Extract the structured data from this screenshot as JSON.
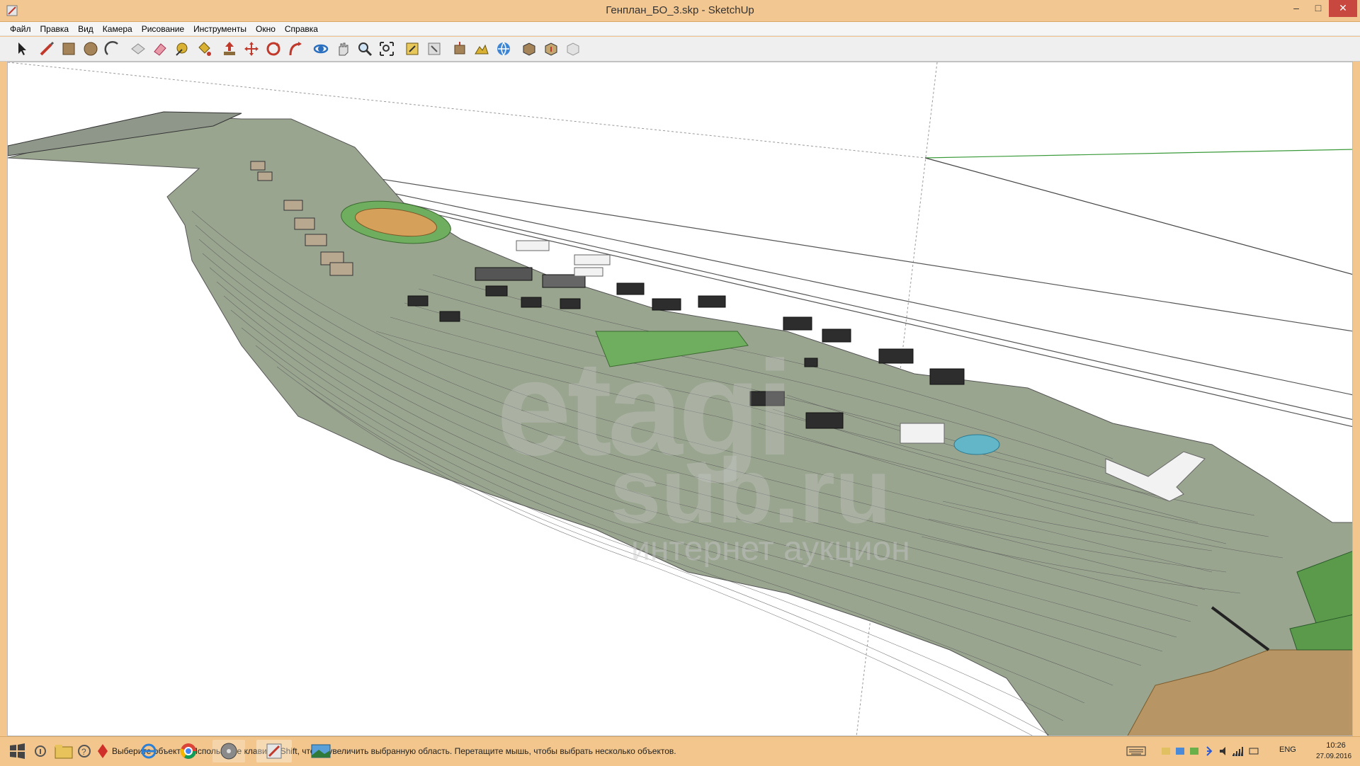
{
  "window": {
    "title": "Генплан_БО_3.skp - SketchUp",
    "controls": {
      "minimize": "–",
      "maximize": "□",
      "close": "✕"
    }
  },
  "menu": [
    {
      "label": "Файл"
    },
    {
      "label": "Правка"
    },
    {
      "label": "Вид"
    },
    {
      "label": "Камера"
    },
    {
      "label": "Рисование"
    },
    {
      "label": "Инструменты"
    },
    {
      "label": "Окно"
    },
    {
      "label": "Справка"
    }
  ],
  "toolbar": {
    "tools": [
      {
        "icon": "select-arrow-icon",
        "color": "#222222"
      },
      {
        "icon": "pencil-line-icon",
        "color": "#c0392b"
      },
      {
        "icon": "rectangle-icon",
        "color": "#8a6d3b"
      },
      {
        "icon": "circle-icon",
        "color": "#8a6d3b"
      },
      {
        "icon": "arc-icon",
        "color": "#444444"
      },
      {
        "icon": "make-component-icon",
        "color": "#9a9a9a"
      },
      {
        "icon": "eraser-icon",
        "color": "#e08a8a"
      },
      {
        "icon": "tape-measure-icon",
        "color": "#c8a020"
      },
      {
        "icon": "paint-bucket-icon",
        "color": "#c8a020"
      },
      {
        "icon": "push-pull-icon",
        "color": "#c0392b"
      },
      {
        "icon": "move-icon",
        "color": "#c0392b"
      },
      {
        "icon": "rotate-icon",
        "color": "#c0392b"
      },
      {
        "icon": "follow-me-icon",
        "color": "#c0392b"
      },
      {
        "icon": "orbit-icon",
        "color": "#2a6fbf"
      },
      {
        "icon": "pan-hand-icon",
        "color": "#666666"
      },
      {
        "icon": "zoom-icon",
        "color": "#555555"
      },
      {
        "icon": "zoom-extents-icon",
        "color": "#555555"
      },
      {
        "icon": "previous-view-icon",
        "color": "#c8a020"
      },
      {
        "icon": "next-view-icon",
        "color": "#9a9a9a"
      },
      {
        "icon": "add-location-icon",
        "color": "#8a5a2b"
      },
      {
        "icon": "toggle-terrain-icon",
        "color": "#c8a020"
      },
      {
        "icon": "get-models-icon",
        "color": "#2a6fbf"
      },
      {
        "icon": "share-model-icon",
        "color": "#8a6d3b"
      },
      {
        "icon": "extension-warehouse-icon",
        "color": "#8a6d3b"
      },
      {
        "icon": "extension-manager-icon",
        "color": "#b0b0b0"
      }
    ]
  },
  "viewport": {
    "model": "Генплан_БО_3",
    "background_color": "#ffffff",
    "terrain_color": "#9aa590",
    "field_color": "#d4a05a",
    "green_color": "#6fae5e",
    "pool_color": "#62b6c8",
    "axis_green": "#3a9a3a",
    "watermark": {
      "line1": "etagi",
      "line2": "sub.ru",
      "line3": "интернет аукцион"
    }
  },
  "status_bar": {
    "text": "Выберите объекты. Используйте клавишу Shift, чтобы увеличить выбранную область. Перетащите мышь, чтобы выбрать несколько объектов."
  },
  "taskbar": {
    "items": [
      {
        "icon": "windows-start-icon"
      },
      {
        "icon": "info-icon"
      },
      {
        "icon": "file-explorer-icon"
      },
      {
        "icon": "help-icon"
      },
      {
        "icon": "poker-app-icon"
      },
      {
        "icon": "internet-explorer-icon"
      },
      {
        "icon": "chrome-icon"
      },
      {
        "icon": "disc-app-icon"
      },
      {
        "icon": "sketchup-icon"
      },
      {
        "icon": "photo-viewer-icon"
      }
    ],
    "tray": {
      "language": "ENG",
      "time": "10:26",
      "date": "27.09.2016"
    }
  }
}
